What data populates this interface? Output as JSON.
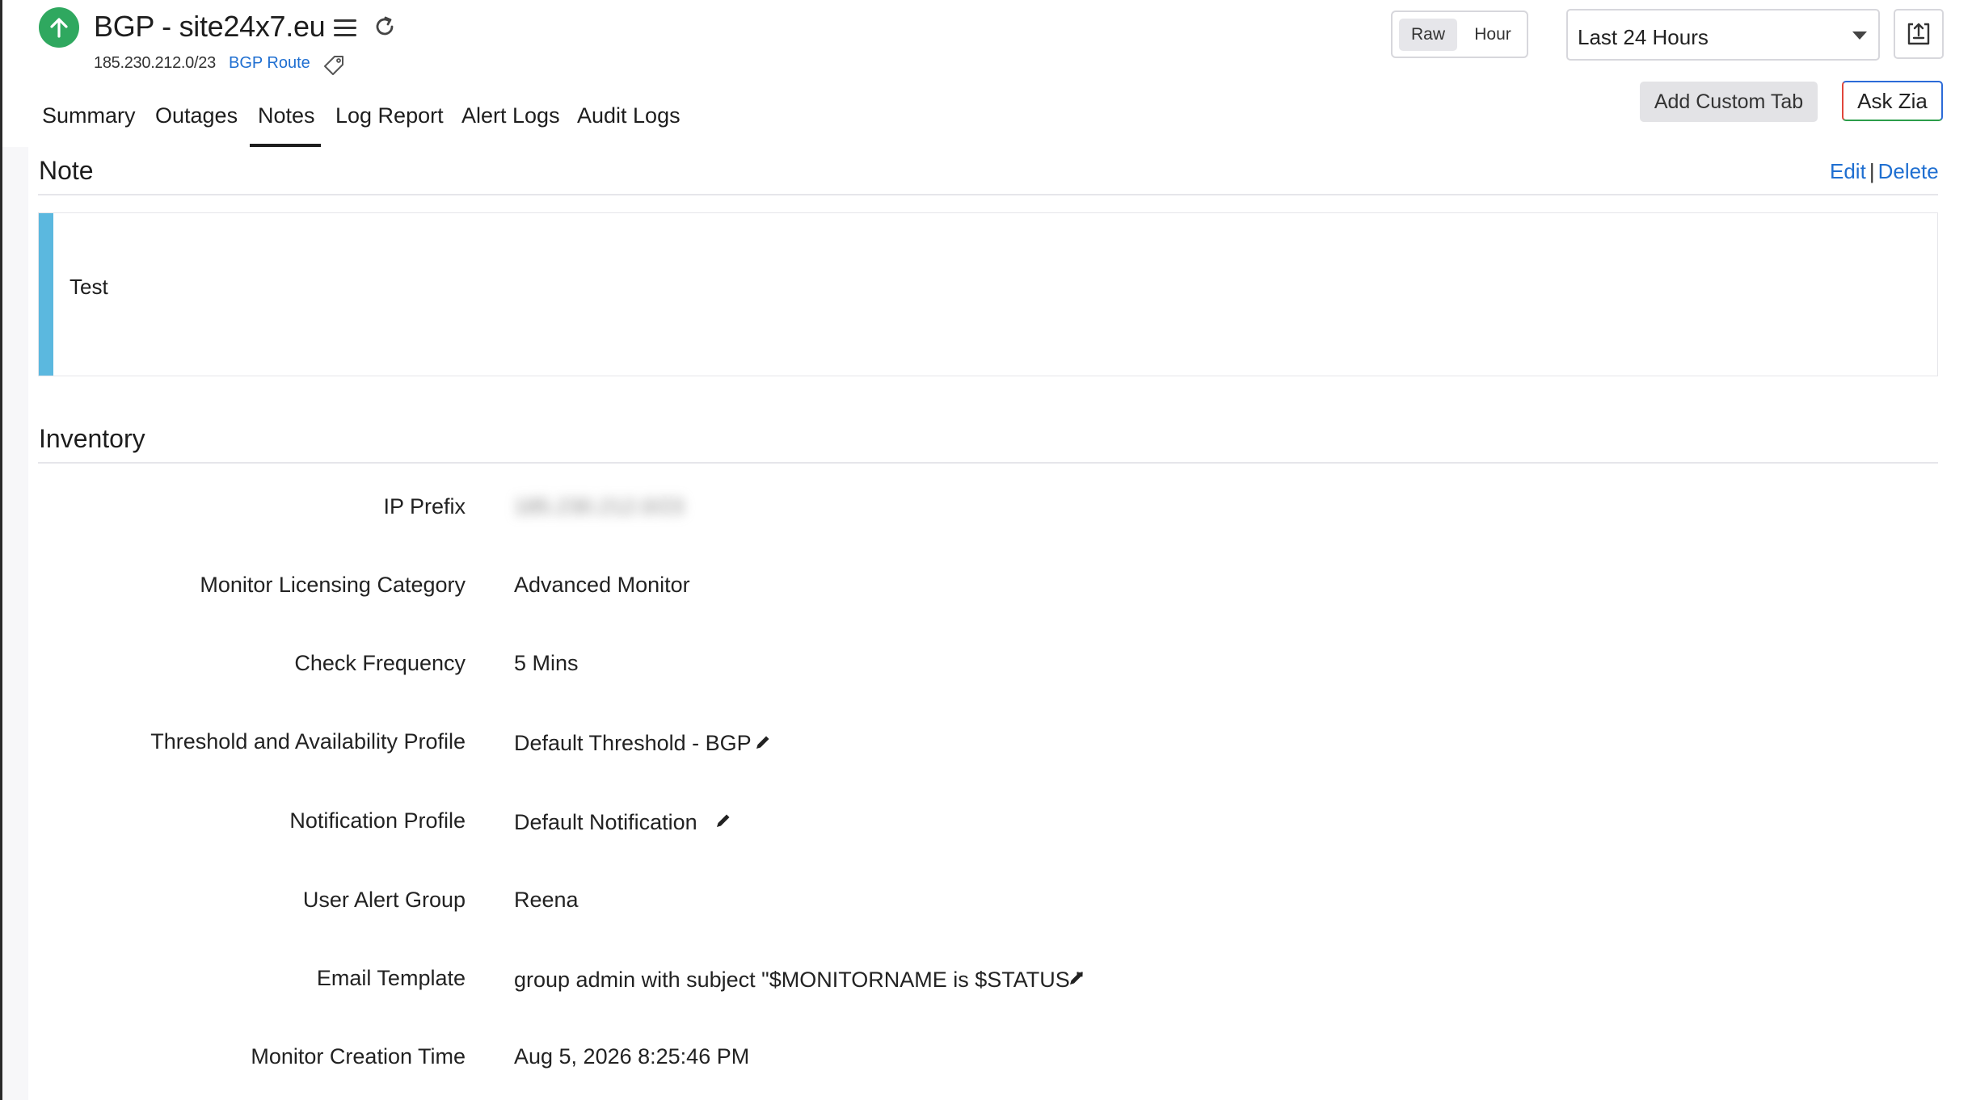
{
  "header": {
    "monitor_title": "BGP - site24x7.eu",
    "status": "up",
    "ip_range": "185.230.212.0/23",
    "monitor_type_link": "BGP Route",
    "status_color": "#2fa85f"
  },
  "toolbar": {
    "view_toggle": [
      "Raw",
      "Hour"
    ],
    "selected_view": "Raw",
    "period_selected": "Last 24 Hours",
    "add_custom_tab": "Add Custom Tab",
    "ask_zia": "Ask Zia"
  },
  "tabs": [
    {
      "label": "Summary"
    },
    {
      "label": "Outages"
    },
    {
      "label": "Notes",
      "active": true
    },
    {
      "label": "Log Report"
    },
    {
      "label": "Alert Logs"
    },
    {
      "label": "Audit Logs"
    }
  ],
  "note": {
    "title": "Note",
    "edit_label": "Edit",
    "separator": "|",
    "delete_label": "Delete",
    "text": "Test",
    "accent_color": "#5bb8df"
  },
  "inventory": {
    "title": "Inventory",
    "rows": [
      {
        "label": "IP Prefix",
        "value": "185.230.212.0/23",
        "blurred": true
      },
      {
        "label": "Monitor Licensing Category",
        "value": "Advanced Monitor"
      },
      {
        "label": "Check Frequency",
        "value": "5 Mins"
      },
      {
        "label": "Threshold and Availability Profile",
        "value": "Default Threshold - BGP",
        "editable": true
      },
      {
        "label": "Notification Profile",
        "value": "Default Notification",
        "editable": true
      },
      {
        "label": "User Alert Group",
        "value": "Reena"
      },
      {
        "label": "Email Template",
        "value": "group admin with subject \"$MONITORNAME is $STATUS \"",
        "editable": true
      },
      {
        "label": "Monitor Creation Time",
        "value": "Aug 5, 2026 8:25:46 PM"
      }
    ]
  },
  "colors": {
    "link": "#1f6fd1",
    "accent_up": "#2fa85f"
  }
}
